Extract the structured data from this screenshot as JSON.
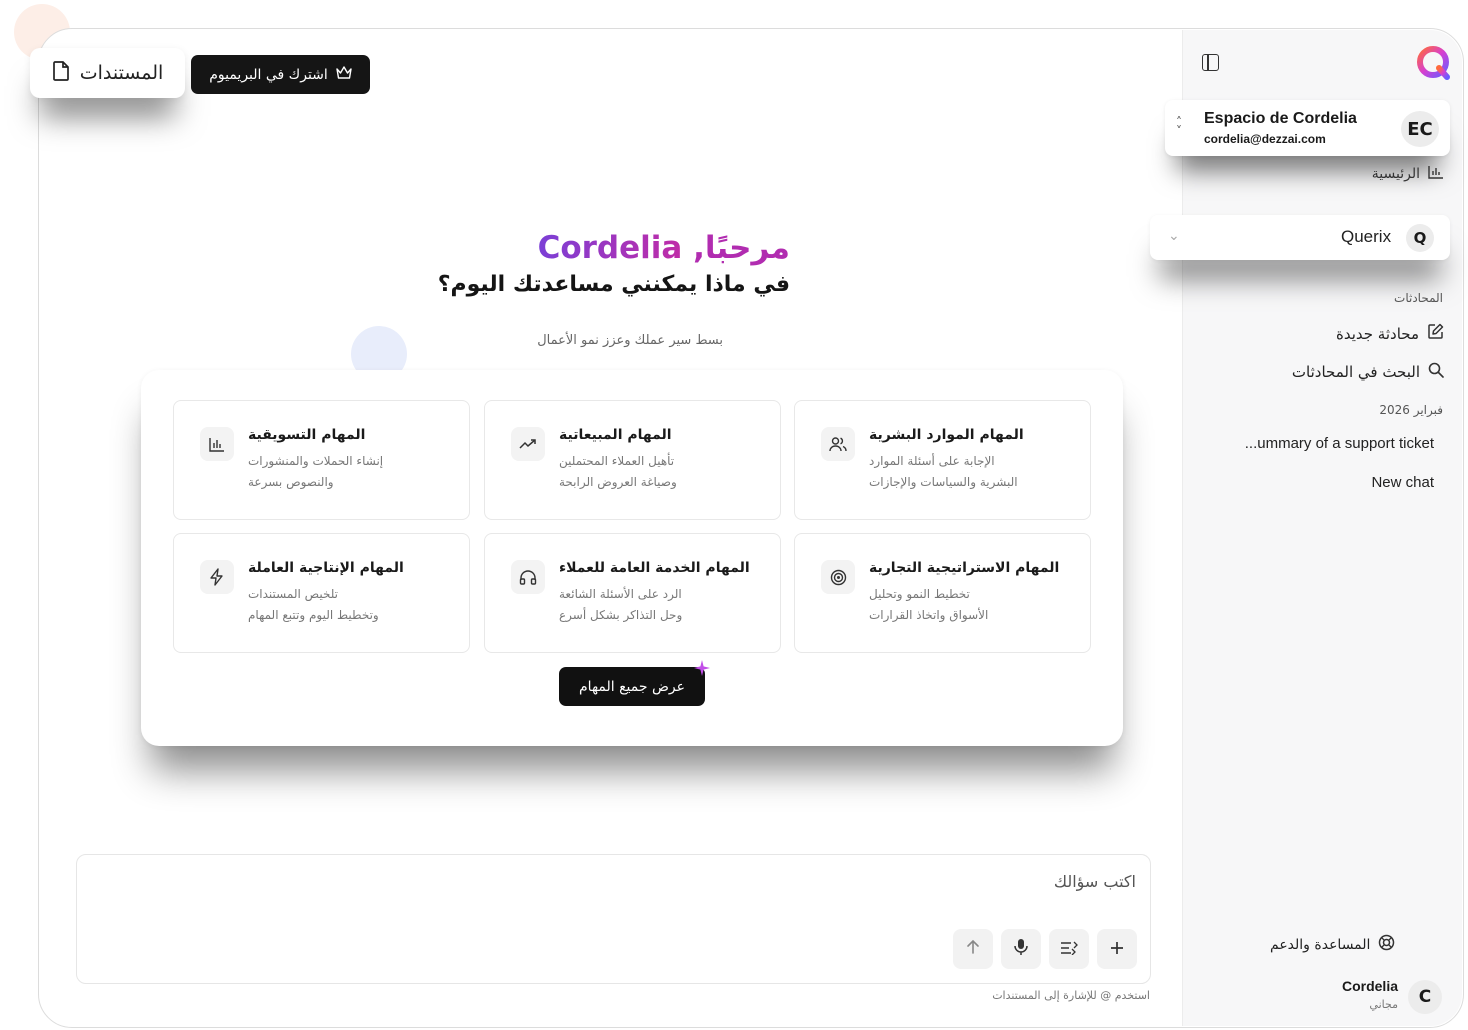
{
  "topbar": {
    "documents_label": "المستندات",
    "premium_label": "اشترك في البريميوم"
  },
  "sidebar": {
    "workspace": {
      "name": "Espacio de Cordelia",
      "email": "cordelia@dezzai.com",
      "initials": "EC"
    },
    "home_label": "الرئيسية",
    "agent": {
      "name": "Querix",
      "initial": "Q"
    },
    "section_chats": "المحادثات",
    "new_chat_label": "محادثة جديدة",
    "search_chats_label": "البحث في المحادثات",
    "date_group": "فبراير 2026",
    "chats": [
      "...ummary of a support ticket",
      "New chat"
    ],
    "help_label": "المساعدة والدعم",
    "user": {
      "name": "Cordelia",
      "plan": "مجاني",
      "initial": "C"
    }
  },
  "main": {
    "greeting": "مرحبًا,",
    "user_name": "Cordelia",
    "question": "في ماذا يمكنني مساعدتك اليوم؟",
    "subtitle": "بسط سير عملك وعزز نمو الأعمال",
    "tasks": [
      {
        "title": "المهام التسويقية",
        "desc1": "إنشاء الحملات والمنشورات",
        "desc2": "والنصوص بسرعة",
        "icon": "bar-chart-icon"
      },
      {
        "title": "المهام المبيعاتية",
        "desc1": "تأهيل العملاء المحتملين",
        "desc2": "وصياغة العروض الرابحة",
        "icon": "trend-up-icon"
      },
      {
        "title": "المهام الموارد البشرية",
        "desc1": "الإجابة على أسئلة الموارد",
        "desc2": "البشرية والسياسات والإجازات",
        "icon": "users-icon"
      },
      {
        "title": "المهام الإنتاجية العاملة",
        "desc1": "تلخيص المستندات",
        "desc2": "وتخطيط اليوم وتتبع المهام",
        "icon": "bolt-icon"
      },
      {
        "title": "المهام الخدمة العامة للعملاء",
        "desc1": "الرد على الأسئلة الشائعة",
        "desc2": "وحل التذاكر بشكل أسرع",
        "icon": "headphones-icon"
      },
      {
        "title": "المهام الاستراتيجية التجارية",
        "desc1": "تخطيط النمو وتحليل",
        "desc2": "الأسواق واتخاذ القرارات",
        "icon": "target-icon"
      }
    ],
    "view_all_label": "عرض جميع المهام",
    "input_placeholder": "اكتب سؤالك",
    "input_hint": "استخدم @ للإشارة إلى المستندات"
  },
  "colors": {
    "accent_purple": "#7b3fd6",
    "accent_magenta": "#c02ca7",
    "dark_button": "#151515",
    "sidebar_bg": "#f7f7f8"
  }
}
